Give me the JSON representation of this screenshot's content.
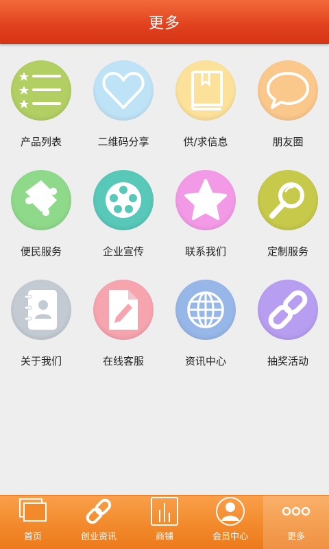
{
  "header": {
    "title": "更多"
  },
  "grid": {
    "items": [
      {
        "label": "产品列表",
        "icon": "list-with-stars-icon",
        "color": "#b2cf63"
      },
      {
        "label": "二维码分享",
        "icon": "heart-icon",
        "color": "#bfe3f6"
      },
      {
        "label": "供/求信息",
        "icon": "book-icon",
        "color": "#fbe199"
      },
      {
        "label": "朋友圈",
        "icon": "speech-bubble-icon",
        "color": "#fbc88c"
      },
      {
        "label": "便民服务",
        "icon": "puzzle-piece-icon",
        "color": "#8fd98a"
      },
      {
        "label": "企业宣传",
        "icon": "film-reel-icon",
        "color": "#58c8b9"
      },
      {
        "label": "联系我们",
        "icon": "star-icon",
        "color": "#f39ae6"
      },
      {
        "label": "定制服务",
        "icon": "magnifier-icon",
        "color": "#c6c94a"
      },
      {
        "label": "关于我们",
        "icon": "address-book-icon",
        "color": "#c3cad2"
      },
      {
        "label": "在线客服",
        "icon": "document-pencil-icon",
        "color": "#f6a4ae"
      },
      {
        "label": "资讯中心",
        "icon": "globe-icon",
        "color": "#97b7e8"
      },
      {
        "label": "抽奖活动",
        "icon": "chain-link-icon",
        "color": "#b79ef0"
      }
    ]
  },
  "tabbar": {
    "items": [
      {
        "label": "首页",
        "icon": "home-windows-icon",
        "active": false
      },
      {
        "label": "创业资讯",
        "icon": "link-icon",
        "active": false
      },
      {
        "label": "商铺",
        "icon": "bar-chart-icon",
        "active": false
      },
      {
        "label": "会员中心",
        "icon": "user-icon",
        "active": false
      },
      {
        "label": "更多",
        "icon": "more-dots-icon",
        "active": true
      }
    ]
  }
}
